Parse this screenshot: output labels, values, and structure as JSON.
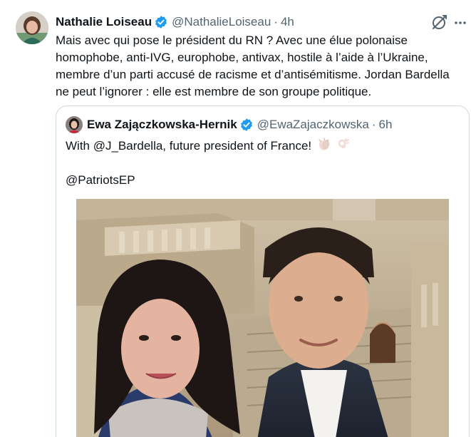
{
  "tweet": {
    "author_name": "Nathalie Loiseau",
    "author_handle": "@NathalieLoiseau",
    "separator": "·",
    "time": "4h",
    "text": "Mais avec qui pose le président du RN ? Avec une élue polonaise homophobe, anti-IVG, europhobe, antivax, hostile à l’aide à l’Ukraine, membre d’un parti accusé de racisme et d’antisémitisme. Jordan Bardella ne peut l’ignorer : elle est membre de son groupe politique."
  },
  "quote": {
    "author_name": "Ewa Zajączkowska-Hernik",
    "author_handle": "@EwaZajaczkowska",
    "separator": "·",
    "time": "6h",
    "text_line1": "With @J_Bardella, future president of France!",
    "text_line2": "@PatriotsEP"
  },
  "icons": {
    "verified": "verified-badge-icon",
    "grok": "grok-icon",
    "more": "more-dots-icon",
    "clap": "clapping-hands-emoji",
    "ok": "ok-hand-emoji"
  },
  "colors": {
    "verified": "#1d9bf0",
    "text_primary": "#0f1419",
    "text_secondary": "#536471",
    "border": "#cfd9de"
  }
}
